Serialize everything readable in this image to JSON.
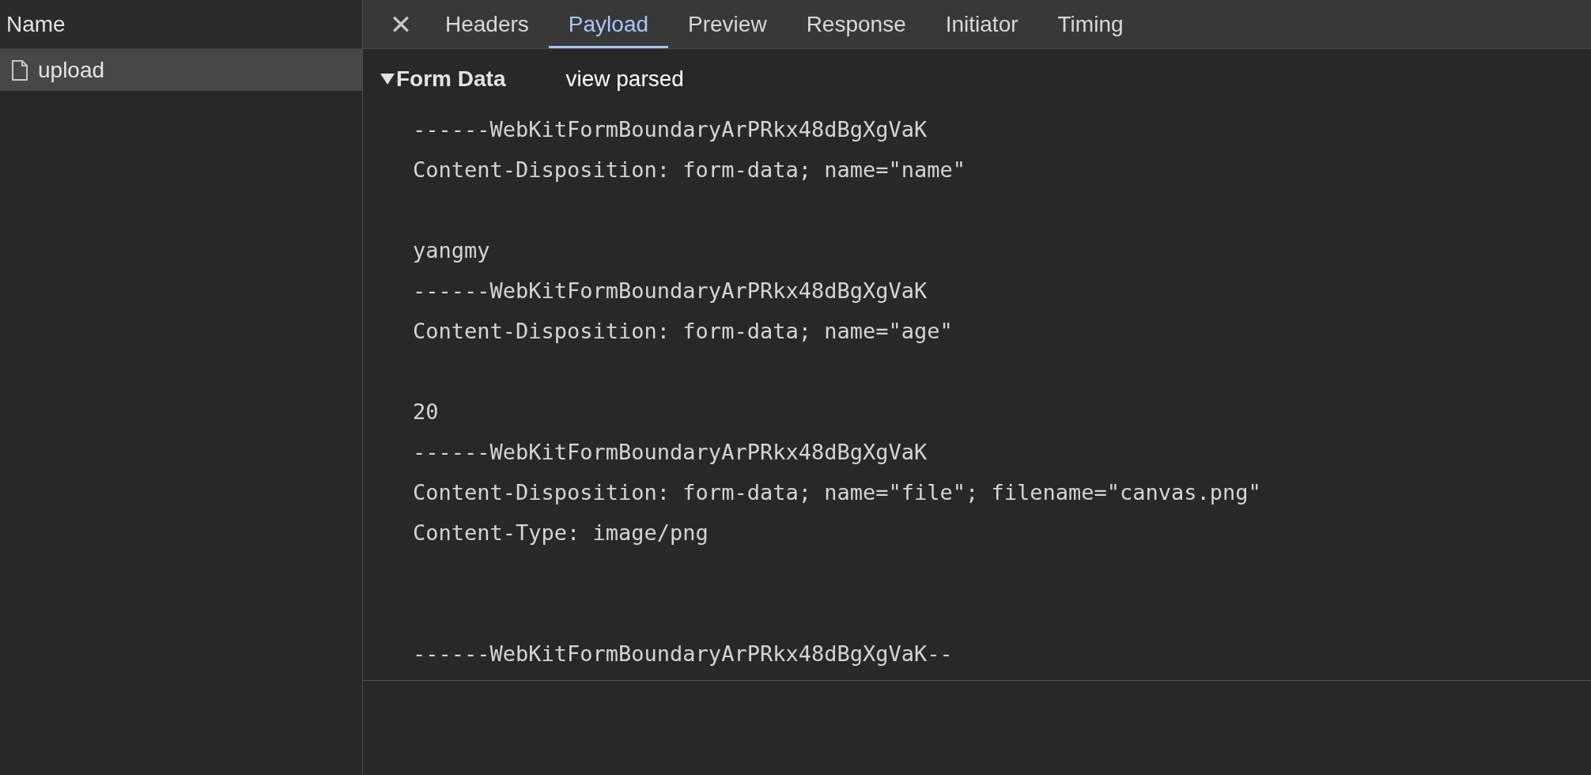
{
  "sidebar": {
    "header": "Name",
    "items": [
      {
        "label": "upload",
        "selected": true
      }
    ]
  },
  "tabs": [
    {
      "label": "Headers",
      "selected": false
    },
    {
      "label": "Payload",
      "selected": true
    },
    {
      "label": "Preview",
      "selected": false
    },
    {
      "label": "Response",
      "selected": false
    },
    {
      "label": "Initiator",
      "selected": false
    },
    {
      "label": "Timing",
      "selected": false
    }
  ],
  "close_icon": "✕",
  "form_data": {
    "title": "Form Data",
    "expanded": true,
    "toggle_label": "view parsed",
    "parts": [
      {
        "boundary": "------WebKitFormBoundaryArPRkx48dBgXgVaK",
        "headers": [
          "Content-Disposition: form-data; name=\"name\""
        ],
        "value": "yangmy"
      },
      {
        "boundary": "------WebKitFormBoundaryArPRkx48dBgXgVaK",
        "headers": [
          "Content-Disposition: form-data; name=\"age\""
        ],
        "value": "20"
      },
      {
        "boundary": "------WebKitFormBoundaryArPRkx48dBgXgVaK",
        "headers": [
          "Content-Disposition: form-data; name=\"file\"; filename=\"canvas.png\"",
          "Content-Type: image/png"
        ]
      }
    ],
    "closing_boundary": "------WebKitFormBoundaryArPRkx48dBgXgVaK--"
  }
}
